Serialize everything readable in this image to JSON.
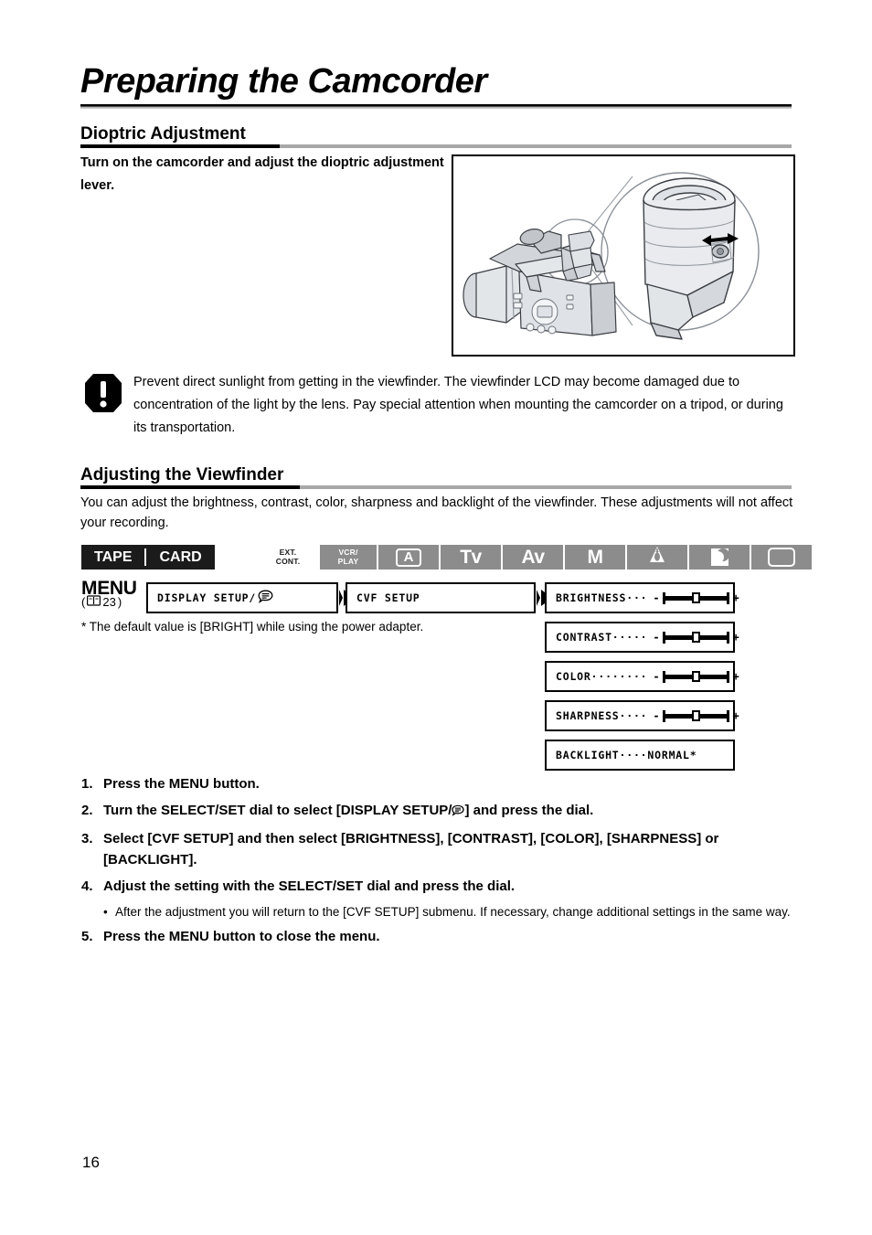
{
  "page": {
    "title": "Preparing the Camcorder",
    "number": "16"
  },
  "dioptric": {
    "heading": "Dioptric Adjustment",
    "instruction": "Turn on the camcorder and adjust the dioptric adjustment lever.",
    "illustration_name": "camcorder-viewfinder-diagram"
  },
  "caution": {
    "icon": "exclamation-warning-icon",
    "text": "Prevent direct sunlight from getting in the viewfinder. The viewfinder LCD may become damaged due to concentration of the light by the lens. Pay special attention when mounting the camcorder on a tripod, or during its transportation."
  },
  "viewfinder": {
    "heading": "Adjusting the Viewfinder",
    "intro": "You can adjust the brightness, contrast, color, sharpness and backlight of the viewfinder. These adjustments will not affect your recording."
  },
  "media_tabs": [
    {
      "label": "TAPE"
    },
    {
      "label": "CARD"
    }
  ],
  "mode_bar": [
    {
      "label": "EXT.\nCONT.",
      "icon": "",
      "style": "light",
      "type": "twoline"
    },
    {
      "label": "VCR/\nPLAY",
      "icon": "",
      "style": "gray",
      "type": "twoline"
    },
    {
      "label": "A",
      "icon": "boxed-a-icon",
      "style": "gray",
      "type": "boxed"
    },
    {
      "label": "Tv",
      "icon": "",
      "style": "gray",
      "type": "big"
    },
    {
      "label": "Av",
      "icon": "",
      "style": "gray",
      "type": "big"
    },
    {
      "label": "M",
      "icon": "",
      "style": "gray",
      "type": "big"
    },
    {
      "label": "",
      "icon": "spotlight-icon",
      "style": "gray",
      "type": "icon"
    },
    {
      "label": "",
      "icon": "night-moon-icon",
      "style": "gray",
      "type": "icon"
    },
    {
      "label": "",
      "icon": "rounded-rect-icon",
      "style": "gray",
      "type": "icon"
    }
  ],
  "menu_flow": {
    "menu_label": "MENU",
    "reference_page": "23",
    "reference_icon": "book-icon",
    "level1": "DISPLAY SETUP/",
    "level1_icon": "display-setup-bubble-icon",
    "level2": "CVF SETUP",
    "settings": [
      {
        "name": "BRIGHTNESS···",
        "type": "slider",
        "minus": "-",
        "plus": "+",
        "value": "center"
      },
      {
        "name": "CONTRAST·····",
        "type": "slider",
        "minus": "-",
        "plus": "+",
        "value": "center"
      },
      {
        "name": "COLOR········",
        "type": "slider",
        "minus": "-",
        "plus": "+",
        "value": "center"
      },
      {
        "name": "SHARPNESS····",
        "type": "slider",
        "minus": "-",
        "plus": "+",
        "value": "center"
      },
      {
        "name": "BACKLIGHT····NORMAL*",
        "type": "value",
        "minus": "",
        "plus": "",
        "value": "NORMAL*"
      }
    ]
  },
  "footnote": "* The default value is [BRIGHT] while using the power adapter.",
  "steps": [
    {
      "num": "1.",
      "text": "Press the MENU button."
    },
    {
      "num": "2.",
      "text": "Turn the SELECT/SET dial to select [DISPLAY SETUP/ ] and press the dial."
    },
    {
      "num": "3.",
      "text": "Select [CVF SETUP] and then select [BRIGHTNESS], [CONTRAST], [COLOR], [SHARPNESS] or [BACKLIGHT]."
    },
    {
      "num": "4.",
      "text": "Adjust the setting with the SELECT/SET dial and press the dial."
    },
    {
      "num": "5.",
      "text": "Press the MENU button to close the menu."
    }
  ],
  "substep": {
    "bullet": "•",
    "text": "After the adjustment you will return to the [CVF SETUP] submenu. If necessary, change additional settings in the same way."
  },
  "colors": {
    "mode_gray": "#8c8c8c",
    "tab_black": "#1b1b1b",
    "rule_gray": "#a8a8a8"
  }
}
